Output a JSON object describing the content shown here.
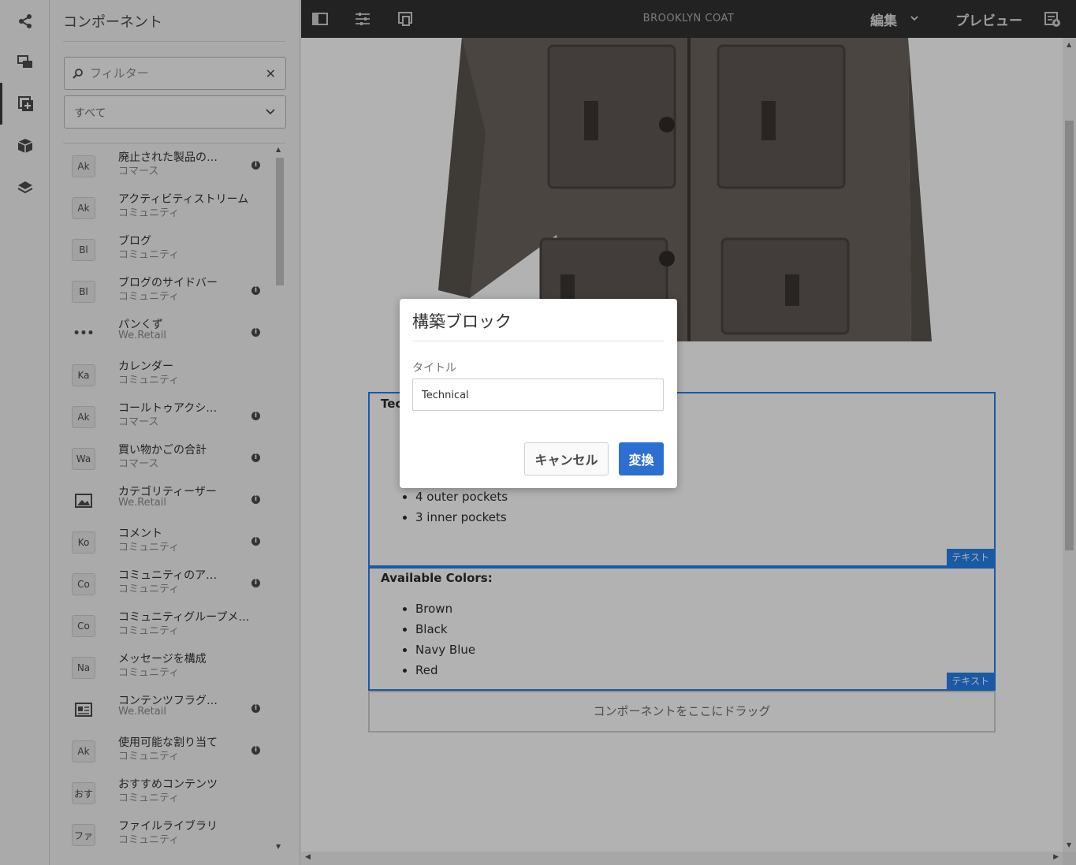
{
  "sidebar": {
    "title": "コンポーネント",
    "filter_placeholder": "フィルター",
    "group_select": "すべて",
    "items": [
      {
        "badge": "Ak",
        "name": "廃止された製品の…",
        "group": "コマース",
        "info": true
      },
      {
        "badge": "Ak",
        "name": "アクティビティストリーム",
        "group": "コミュニティ",
        "info": false
      },
      {
        "badge": "Bl",
        "name": "ブログ",
        "group": "コミュニティ",
        "info": false
      },
      {
        "badge": "Bl",
        "name": "ブログのサイドバー",
        "group": "コミュニティ",
        "info": true
      },
      {
        "badge": "•••",
        "name": "パンくず",
        "group": "We.Retail",
        "info": true
      },
      {
        "badge": "Ka",
        "name": "カレンダー",
        "group": "コミュニティ",
        "info": false
      },
      {
        "badge": "Ak",
        "name": "コールトゥアクシ…",
        "group": "コマース",
        "info": true
      },
      {
        "badge": "Wa",
        "name": "買い物かごの合計",
        "group": "コマース",
        "info": true
      },
      {
        "badge": "image-icon",
        "name": "カテゴリティーザー",
        "group": "We.Retail",
        "info": true
      },
      {
        "badge": "Ko",
        "name": "コメント",
        "group": "コミュニティ",
        "info": true
      },
      {
        "badge": "Co",
        "name": "コミュニティのア…",
        "group": "コミュニティ",
        "info": true
      },
      {
        "badge": "Co",
        "name": "コミュニティグループメ…",
        "group": "コミュニティ",
        "info": false
      },
      {
        "badge": "Na",
        "name": "メッセージを構成",
        "group": "コミュニティ",
        "info": false
      },
      {
        "badge": "content-fragment-icon",
        "name": "コンテンツフラグ…",
        "group": "We.Retail",
        "info": true
      },
      {
        "badge": "Ak",
        "name": "使用可能な割り当て",
        "group": "コミュニティ",
        "info": true
      },
      {
        "badge": "おす",
        "name": "おすすめコンテンツ",
        "group": "コミュニティ",
        "info": false
      },
      {
        "badge": "ファ",
        "name": "ファイルライブラリ",
        "group": "コミュニティ",
        "info": false
      }
    ]
  },
  "toolbar": {
    "page_title": "BROOKLYN COAT",
    "mode": "編集",
    "preview": "プレビュー"
  },
  "canvas": {
    "tech_heading": "Tec",
    "tech_items": [
      "4 outer pockets",
      "3 inner pockets"
    ],
    "colors_heading": "Available Colors:",
    "colors_items": [
      "Brown",
      "Black",
      "Navy Blue",
      "Red"
    ],
    "block_label": "テキスト",
    "dropzone": "コンポーネントをここにドラッグ"
  },
  "dialog": {
    "title": "構築ブロック",
    "field_label": "タイトル",
    "field_value": "Technical",
    "cancel": "キャンセル",
    "confirm": "変換"
  },
  "colors": {
    "accent": "#2680eb",
    "primary_button": "#2d6fd1",
    "toolbar_bg": "#323232"
  }
}
